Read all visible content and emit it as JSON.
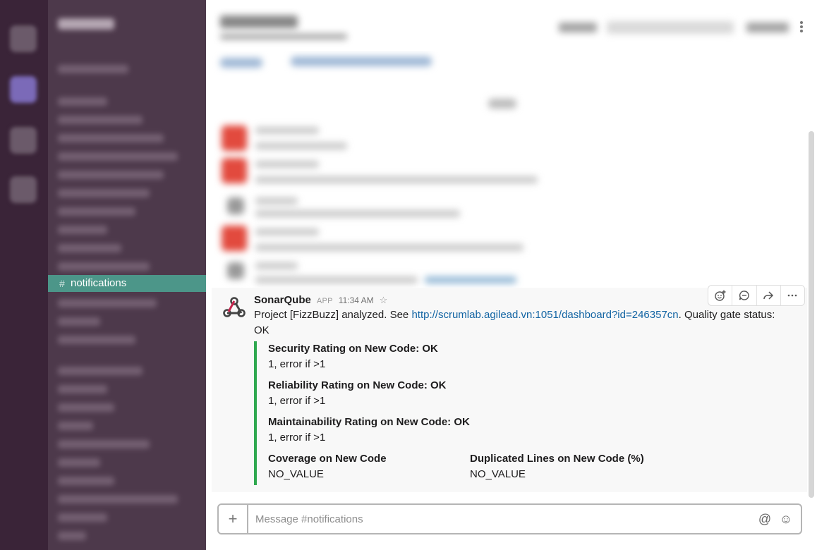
{
  "sidebar": {
    "active_channel": {
      "hash": "#",
      "label": "notifications"
    }
  },
  "message": {
    "sender": "SonarQube",
    "app_tag": "APP",
    "time": "11:34 AM",
    "text_prefix": "Project [FizzBuzz] analyzed. See ",
    "link": "http://scrumlab.agilead.vn:1051/dashboard?id=246357cn",
    "text_suffix": ". Quality gate status: OK",
    "attachment_color": "#2fa84f",
    "fields": [
      {
        "title": "Security Rating on New Code: OK",
        "value": "1, error if >1"
      },
      {
        "title": "Reliability Rating on New Code: OK",
        "value": "1, error if >1"
      },
      {
        "title": "Maintainability Rating on New Code: OK",
        "value": "1, error if >1"
      },
      {
        "title": "Coverage on New Code",
        "value": "NO_VALUE"
      },
      {
        "title": "Duplicated Lines on New Code (%)",
        "value": "NO_VALUE"
      }
    ]
  },
  "actions": {
    "icons": [
      "add-reaction-icon",
      "reply-thread-icon",
      "share-icon",
      "more-actions-icon"
    ]
  },
  "composer": {
    "placeholder": "Message #notifications",
    "plus": "+",
    "at": "@",
    "emoji": "☺"
  },
  "colors": {
    "sidebar_bg": "#4d394b",
    "active_channel_bg": "#4c9689",
    "link": "#1264a3"
  }
}
